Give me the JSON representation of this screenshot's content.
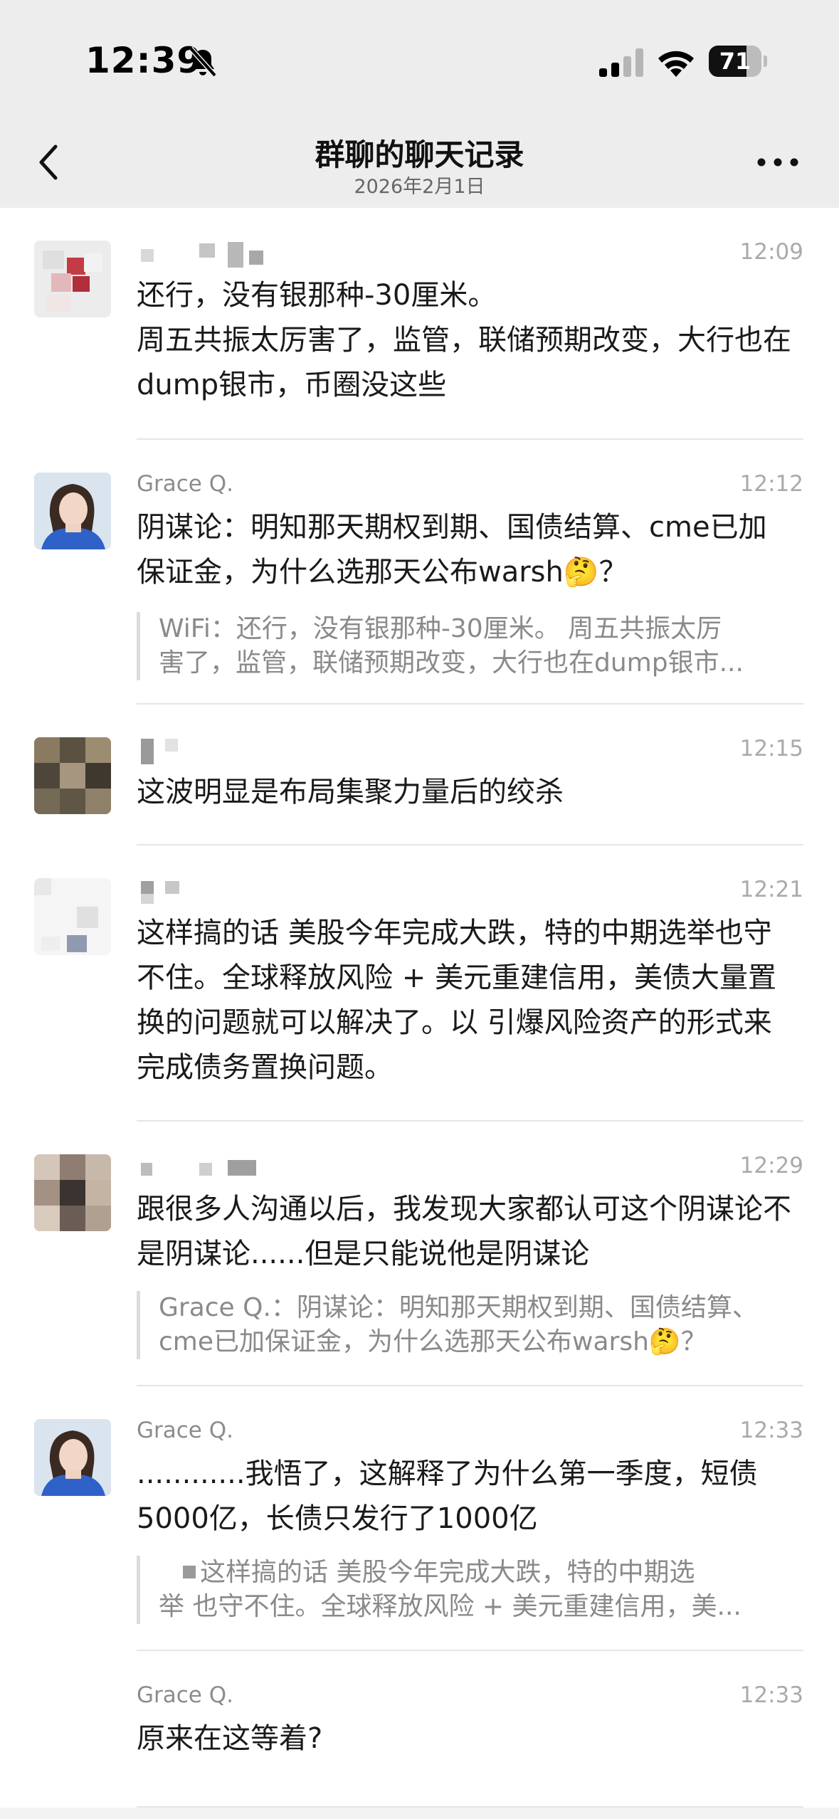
{
  "status_bar": {
    "time": "12:39",
    "battery": "71",
    "battery_level": 0.71,
    "icons": [
      "bell-slash-icon",
      "cellular-signal-icon",
      "wifi-icon",
      "battery-icon"
    ]
  },
  "header": {
    "title": "群聊的聊天记录",
    "subtitle": "2026年2月1日",
    "back_icon": "chevron-left-icon",
    "more_icon": "ellipsis-icon"
  },
  "messages": [
    {
      "sender": "",
      "time": "12:09",
      "text": "还行，没有银那种-30厘米。\n周五共振太厉害了，监管，联储预期改变，大行也在dump银市，币圈没这些",
      "quote": ""
    },
    {
      "sender": "Grace Q.",
      "time": "12:12",
      "text": "阴谋论：明知那天期权到期、国债结算、cme已加保证金，为什么选那天公布warsh🤔？",
      "quote_line1": "WiFi：还行，没有银那种-30厘米。 周五共振太厉",
      "quote_line2": "害了，监管，联储预期改变，大行也在dump银市..."
    },
    {
      "sender": "",
      "time": "12:15",
      "text": "这波明显是布局集聚力量后的绞杀",
      "quote": ""
    },
    {
      "sender": "",
      "time": "12:21",
      "text": "这样搞的话 美股今年完成大跌，特的中期选举也守不住。全球释放风险 + 美元重建信用，美债大量置换的问题就可以解决了。以 引爆风险资产的形式来完成债务置换问题。",
      "quote": ""
    },
    {
      "sender": "",
      "time": "12:29",
      "text": "跟很多人沟通以后，我发现大家都认可这个阴谋论不是阴谋论......但是只能说他是阴谋论",
      "quote_line1": "Grace Q.：阴谋论：明知那天期权到期、国债结算、",
      "quote_line2": "cme已加保证金，为什么选那天公布warsh🤔？"
    },
    {
      "sender": "Grace Q.",
      "time": "12:33",
      "text": "............我悟了，这解释了为什么第一季度，短债5000亿，长债只发行了1000亿",
      "quote_line1": "这样搞的话 美股今年完成大跌，特的中期选",
      "quote_line2": "举 也守不住。全球释放风险 + 美元重建信用，美..."
    },
    {
      "sender": "Grace Q.",
      "time": "12:33",
      "text": "原来在这等着?",
      "quote": ""
    }
  ]
}
